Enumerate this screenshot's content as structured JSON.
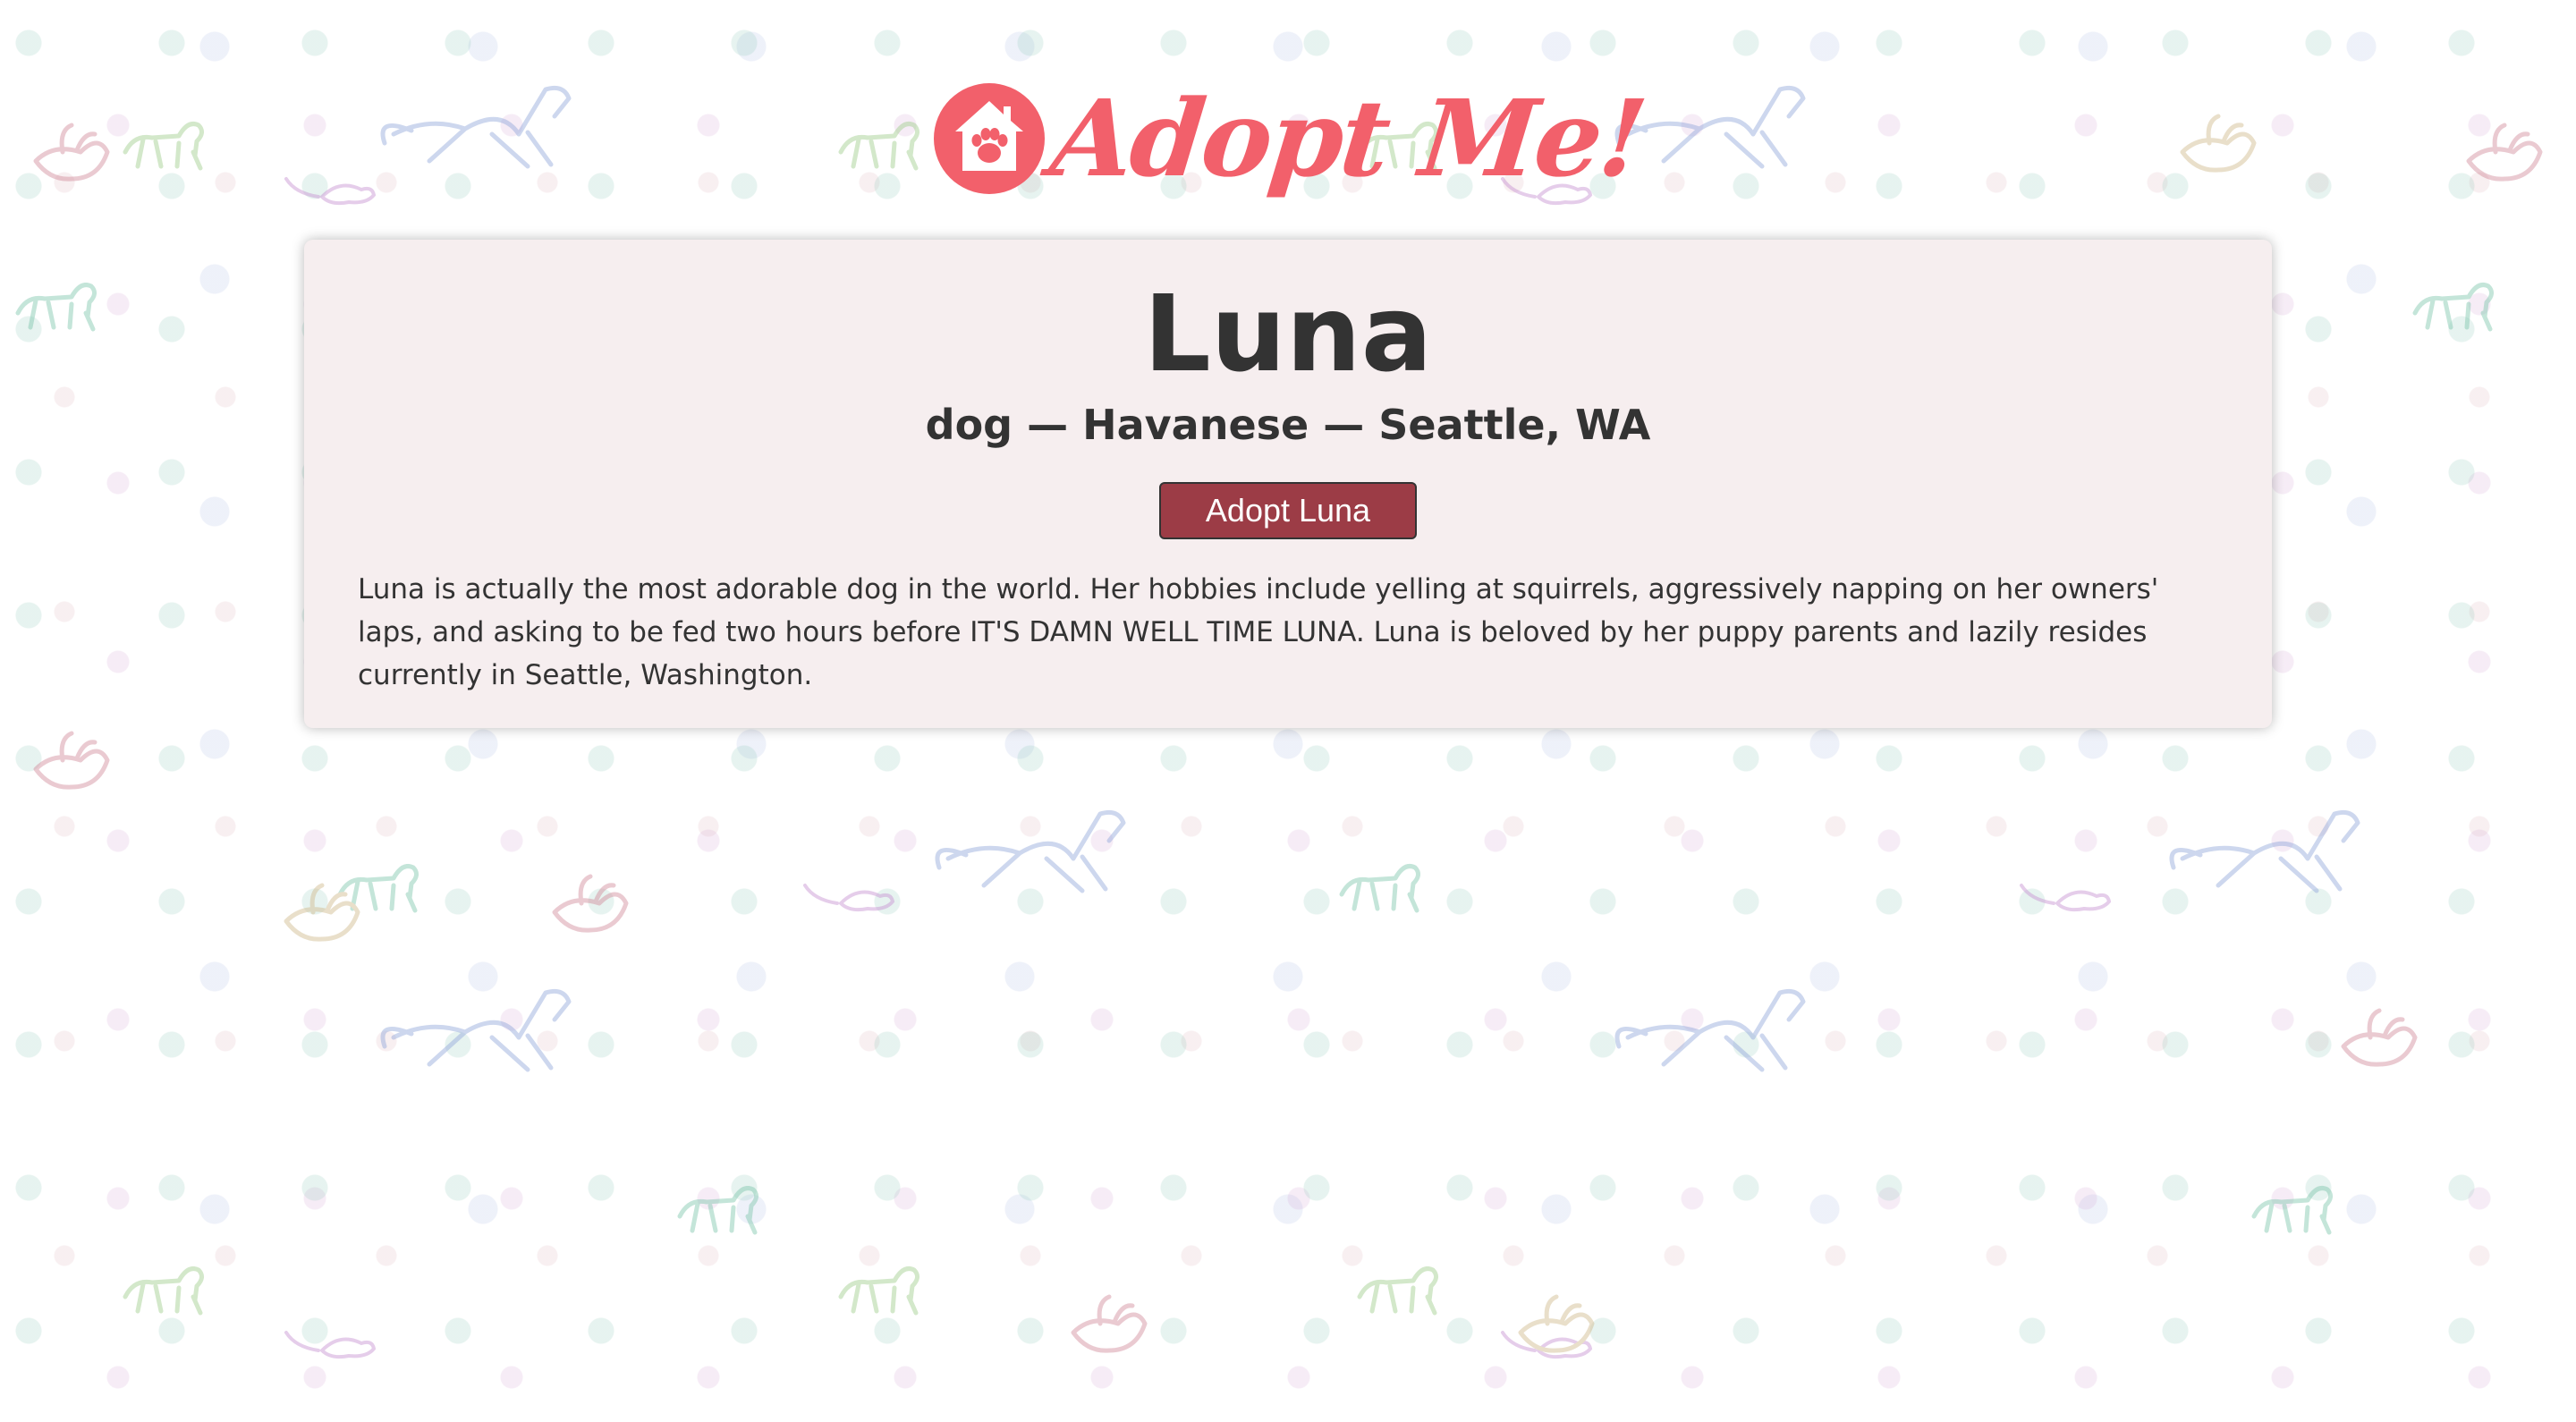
{
  "brand": {
    "name": "Adopt Me!",
    "color": "#f2606b",
    "icon": "house-paw-icon"
  },
  "pet": {
    "name": "Luna",
    "meta": "dog — Havanese — Seattle, WA",
    "adopt_label": "Adopt Luna",
    "description": "Luna is actually the most adorable dog in the world. Her hobbies include yelling at squirrels, aggressively napping on her owners' laps, and asking to be fed two hours before IT'S DAMN WELL TIME LUNA. Luna is beloved by her puppy parents and lazily resides currently in Seattle, Washington."
  },
  "colors": {
    "card_background": "#f6eeef",
    "button_background": "#9c3c46",
    "text": "#333333"
  }
}
